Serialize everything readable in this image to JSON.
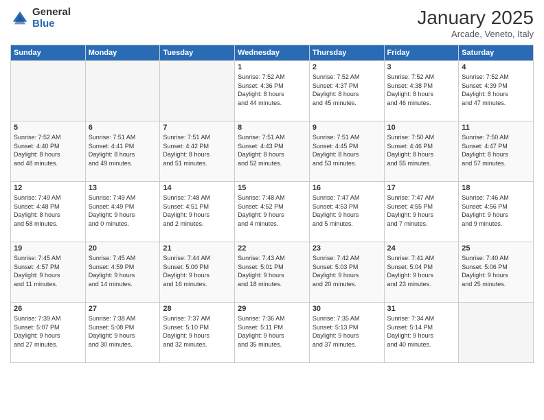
{
  "logo": {
    "general": "General",
    "blue": "Blue"
  },
  "header": {
    "month": "January 2025",
    "location": "Arcade, Veneto, Italy"
  },
  "days_of_week": [
    "Sunday",
    "Monday",
    "Tuesday",
    "Wednesday",
    "Thursday",
    "Friday",
    "Saturday"
  ],
  "weeks": [
    [
      {
        "day": "",
        "info": ""
      },
      {
        "day": "",
        "info": ""
      },
      {
        "day": "",
        "info": ""
      },
      {
        "day": "1",
        "info": "Sunrise: 7:52 AM\nSunset: 4:36 PM\nDaylight: 8 hours\nand 44 minutes."
      },
      {
        "day": "2",
        "info": "Sunrise: 7:52 AM\nSunset: 4:37 PM\nDaylight: 8 hours\nand 45 minutes."
      },
      {
        "day": "3",
        "info": "Sunrise: 7:52 AM\nSunset: 4:38 PM\nDaylight: 8 hours\nand 46 minutes."
      },
      {
        "day": "4",
        "info": "Sunrise: 7:52 AM\nSunset: 4:39 PM\nDaylight: 8 hours\nand 47 minutes."
      }
    ],
    [
      {
        "day": "5",
        "info": "Sunrise: 7:52 AM\nSunset: 4:40 PM\nDaylight: 8 hours\nand 48 minutes."
      },
      {
        "day": "6",
        "info": "Sunrise: 7:51 AM\nSunset: 4:41 PM\nDaylight: 8 hours\nand 49 minutes."
      },
      {
        "day": "7",
        "info": "Sunrise: 7:51 AM\nSunset: 4:42 PM\nDaylight: 8 hours\nand 51 minutes."
      },
      {
        "day": "8",
        "info": "Sunrise: 7:51 AM\nSunset: 4:43 PM\nDaylight: 8 hours\nand 52 minutes."
      },
      {
        "day": "9",
        "info": "Sunrise: 7:51 AM\nSunset: 4:45 PM\nDaylight: 8 hours\nand 53 minutes."
      },
      {
        "day": "10",
        "info": "Sunrise: 7:50 AM\nSunset: 4:46 PM\nDaylight: 8 hours\nand 55 minutes."
      },
      {
        "day": "11",
        "info": "Sunrise: 7:50 AM\nSunset: 4:47 PM\nDaylight: 8 hours\nand 57 minutes."
      }
    ],
    [
      {
        "day": "12",
        "info": "Sunrise: 7:49 AM\nSunset: 4:48 PM\nDaylight: 8 hours\nand 58 minutes."
      },
      {
        "day": "13",
        "info": "Sunrise: 7:49 AM\nSunset: 4:49 PM\nDaylight: 9 hours\nand 0 minutes."
      },
      {
        "day": "14",
        "info": "Sunrise: 7:48 AM\nSunset: 4:51 PM\nDaylight: 9 hours\nand 2 minutes."
      },
      {
        "day": "15",
        "info": "Sunrise: 7:48 AM\nSunset: 4:52 PM\nDaylight: 9 hours\nand 4 minutes."
      },
      {
        "day": "16",
        "info": "Sunrise: 7:47 AM\nSunset: 4:53 PM\nDaylight: 9 hours\nand 5 minutes."
      },
      {
        "day": "17",
        "info": "Sunrise: 7:47 AM\nSunset: 4:55 PM\nDaylight: 9 hours\nand 7 minutes."
      },
      {
        "day": "18",
        "info": "Sunrise: 7:46 AM\nSunset: 4:56 PM\nDaylight: 9 hours\nand 9 minutes."
      }
    ],
    [
      {
        "day": "19",
        "info": "Sunrise: 7:45 AM\nSunset: 4:57 PM\nDaylight: 9 hours\nand 11 minutes."
      },
      {
        "day": "20",
        "info": "Sunrise: 7:45 AM\nSunset: 4:59 PM\nDaylight: 9 hours\nand 14 minutes."
      },
      {
        "day": "21",
        "info": "Sunrise: 7:44 AM\nSunset: 5:00 PM\nDaylight: 9 hours\nand 16 minutes."
      },
      {
        "day": "22",
        "info": "Sunrise: 7:43 AM\nSunset: 5:01 PM\nDaylight: 9 hours\nand 18 minutes."
      },
      {
        "day": "23",
        "info": "Sunrise: 7:42 AM\nSunset: 5:03 PM\nDaylight: 9 hours\nand 20 minutes."
      },
      {
        "day": "24",
        "info": "Sunrise: 7:41 AM\nSunset: 5:04 PM\nDaylight: 9 hours\nand 23 minutes."
      },
      {
        "day": "25",
        "info": "Sunrise: 7:40 AM\nSunset: 5:06 PM\nDaylight: 9 hours\nand 25 minutes."
      }
    ],
    [
      {
        "day": "26",
        "info": "Sunrise: 7:39 AM\nSunset: 5:07 PM\nDaylight: 9 hours\nand 27 minutes."
      },
      {
        "day": "27",
        "info": "Sunrise: 7:38 AM\nSunset: 5:08 PM\nDaylight: 9 hours\nand 30 minutes."
      },
      {
        "day": "28",
        "info": "Sunrise: 7:37 AM\nSunset: 5:10 PM\nDaylight: 9 hours\nand 32 minutes."
      },
      {
        "day": "29",
        "info": "Sunrise: 7:36 AM\nSunset: 5:11 PM\nDaylight: 9 hours\nand 35 minutes."
      },
      {
        "day": "30",
        "info": "Sunrise: 7:35 AM\nSunset: 5:13 PM\nDaylight: 9 hours\nand 37 minutes."
      },
      {
        "day": "31",
        "info": "Sunrise: 7:34 AM\nSunset: 5:14 PM\nDaylight: 9 hours\nand 40 minutes."
      },
      {
        "day": "",
        "info": ""
      }
    ]
  ]
}
